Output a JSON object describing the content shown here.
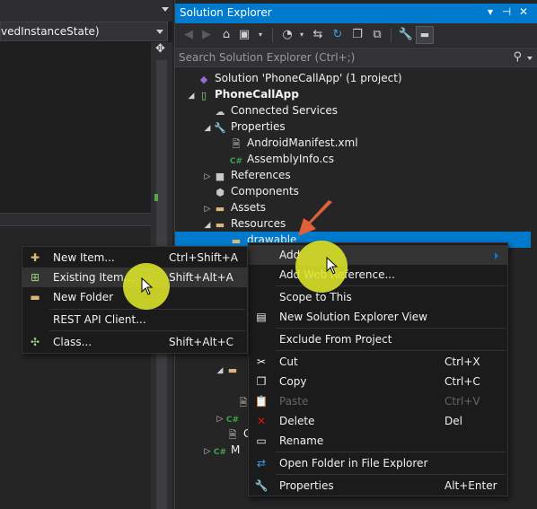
{
  "editor": {
    "member_dropdown": "vedInstanceState)"
  },
  "solution_explorer": {
    "title": "Solution Explorer",
    "title_buttons": [
      "▾",
      "⊣",
      "✕"
    ],
    "search_placeholder": "Search Solution Explorer (Ctrl+;)",
    "tree": {
      "solution": "Solution 'PhoneCallApp' (1 project)",
      "project": "PhoneCallApp",
      "connected_services": "Connected Services",
      "properties": "Properties",
      "android_manifest": "AndroidManifest.xml",
      "assembly_info": "AssemblyInfo.cs",
      "references": "References",
      "components": "Components",
      "assets": "Assets",
      "resources": "Resources",
      "drawable": "drawable",
      "partial_ge": "Ge",
      "partial_m": "M"
    }
  },
  "context_menu": {
    "items": [
      {
        "label": "Add",
        "shortcut": ""
      },
      {
        "label": "Add Web Reference...",
        "shortcut": ""
      },
      {
        "label": "Scope to This",
        "shortcut": ""
      },
      {
        "label": "New Solution Explorer View",
        "shortcut": ""
      },
      {
        "label": "Exclude From Project",
        "shortcut": ""
      },
      {
        "label": "Cut",
        "shortcut": "Ctrl+X"
      },
      {
        "label": "Copy",
        "shortcut": "Ctrl+C"
      },
      {
        "label": "Paste",
        "shortcut": "Ctrl+V"
      },
      {
        "label": "Delete",
        "shortcut": "Del"
      },
      {
        "label": "Rename",
        "shortcut": ""
      },
      {
        "label": "Open Folder in File Explorer",
        "shortcut": ""
      },
      {
        "label": "Properties",
        "shortcut": "Alt+Enter"
      }
    ]
  },
  "add_submenu": {
    "items": [
      {
        "label": "New Item...",
        "shortcut": "Ctrl+Shift+A"
      },
      {
        "label": "Existing Item...",
        "shortcut": "Shift+Alt+A"
      },
      {
        "label": "New Folder",
        "shortcut": ""
      },
      {
        "label": "REST API Client...",
        "shortcut": ""
      },
      {
        "label": "Class...",
        "shortcut": "Shift+Alt+C"
      }
    ]
  },
  "colors": {
    "accent": "#007acc",
    "highlight": "#dee628",
    "arrow": "#e0603a"
  }
}
